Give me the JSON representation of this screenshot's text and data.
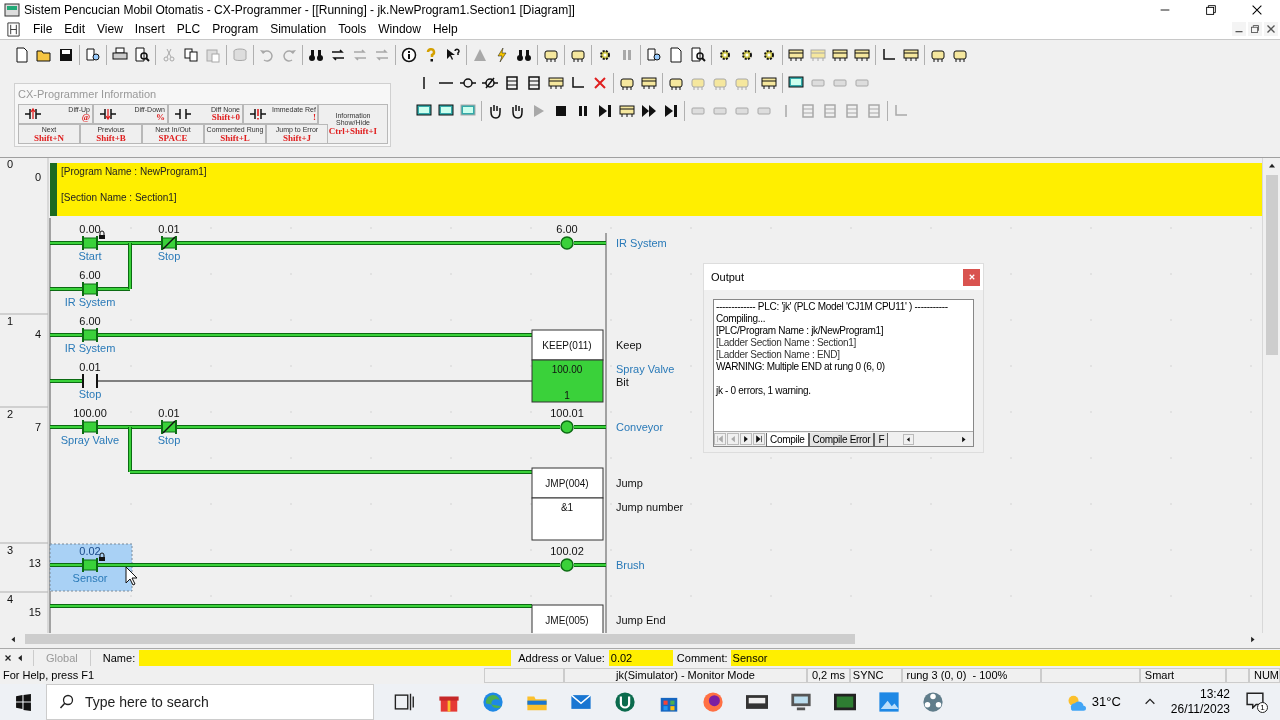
{
  "window": {
    "title": "Sistem Pencucian Mobil Otomatis - CX-Programmer - [[Running] - jk.NewProgram1.Section1 [Diagram]]"
  },
  "menu": [
    "File",
    "Edit",
    "View",
    "Insert",
    "PLC",
    "Program",
    "Simulation",
    "Tools",
    "Window",
    "Help"
  ],
  "info_panel": {
    "title": "CX-Programmer Information",
    "keys": [
      {
        "kind": "diff",
        "label": "Diff-Up",
        "key": "@"
      },
      {
        "kind": "diff",
        "label": "Diff-Down",
        "key": "%"
      },
      {
        "kind": "diff",
        "label": "Diff None",
        "key": "Shift+0"
      },
      {
        "kind": "diff",
        "label": "Immedate Ref",
        "key": "!"
      },
      {
        "kind": "info",
        "label": "Information Show/Hide",
        "key": "Ctrl+Shift+I"
      },
      {
        "kind": "nav",
        "label": "Next",
        "key": "Shift+N"
      },
      {
        "kind": "nav",
        "label": "Previous",
        "key": "Shift+B"
      },
      {
        "kind": "nav",
        "label": "Next In/Out",
        "key": "SPACE"
      },
      {
        "kind": "nav",
        "label": "Commented Rung",
        "key": "Shift+L"
      },
      {
        "kind": "nav",
        "label": "Jump to Error",
        "key": "Shift+J"
      }
    ]
  },
  "ladder": {
    "rungs": [
      {
        "number": "0",
        "step": "0",
        "comment": [
          "[Program Name : NewProgram1]",
          "[Section Name : Section1]"
        ],
        "elements": [
          {
            "kind": "contact_no",
            "address": "0.00",
            "symbol": "Start",
            "energized": true,
            "locked": true,
            "selected": false
          },
          {
            "kind": "contact_nc",
            "address": "0.01",
            "symbol": "Stop",
            "energized": true,
            "locked": false,
            "selected": false
          },
          {
            "kind": "coil",
            "address": "6.00",
            "symbol": "IR System",
            "energized": true,
            "selected": false
          },
          {
            "kind": "contact_no",
            "address": "6.00",
            "symbol": "IR System",
            "energized": true,
            "locked": false,
            "selected": false
          }
        ]
      },
      {
        "number": "1",
        "step": "4",
        "elements": [
          {
            "kind": "contact_no",
            "address": "6.00",
            "symbol": "IR System",
            "energized": true,
            "locked": false,
            "selected": false
          },
          {
            "kind": "contact_no",
            "address": "0.01",
            "symbol": "Stop",
            "energized": false,
            "locked": false,
            "selected": false
          },
          {
            "kind": "instruction",
            "mnemonic": "KEEP(011)",
            "description": "Keep",
            "selected": false,
            "operands": [
              {
                "value": "100.00",
                "current": "1",
                "symbol": "Spray Valve",
                "description": "Bit",
                "energized": true
              }
            ]
          }
        ]
      },
      {
        "number": "2",
        "step": "7",
        "elements": [
          {
            "kind": "contact_no",
            "address": "100.00",
            "symbol": "Spray Valve",
            "energized": true,
            "locked": false,
            "selected": false
          },
          {
            "kind": "contact_nc",
            "address": "0.01",
            "symbol": "Stop",
            "energized": true,
            "locked": false,
            "selected": false
          },
          {
            "kind": "coil",
            "address": "100.01",
            "symbol": "Conveyor",
            "energized": true,
            "selected": false
          },
          {
            "kind": "instruction",
            "mnemonic": "JMP(004)",
            "description": "Jump",
            "selected": false,
            "operands": [
              {
                "value": "&1",
                "description": "Jump number",
                "energized": false
              }
            ]
          }
        ]
      },
      {
        "number": "3",
        "step": "13",
        "elements": [
          {
            "kind": "contact_no",
            "address": "0.02",
            "symbol": "Sensor",
            "energized": true,
            "locked": true,
            "selected": true
          },
          {
            "kind": "coil",
            "address": "100.02",
            "symbol": "Brush",
            "energized": true,
            "selected": false
          }
        ]
      },
      {
        "number": "4",
        "step": "15",
        "elements": [
          {
            "kind": "instruction",
            "mnemonic": "JME(005)",
            "description": "Jump End",
            "selected": false
          }
        ]
      }
    ]
  },
  "output": {
    "title": "Output",
    "log": [
      "------------- PLC: 'jk' (PLC Model 'CJ1M CPU11' ) -----------",
      "Compiling...",
      "[PLC/Program Name : jk/NewProgram1]",
      "[Ladder Section Name : Section1]",
      "[Ladder Section Name : END]",
      "WARNING: Multiple END at rung 0 (6, 0)"
    ],
    "summary": [
      "jk - 0 errors, 1 warning."
    ],
    "tabs": [
      {
        "label": "Compile",
        "selected": true
      },
      {
        "label": "Compile Error",
        "selected": false
      },
      {
        "label": "F",
        "selected": false
      }
    ]
  },
  "info_bar": {
    "scope": "Global",
    "name_label": "Name:",
    "address_label": "Address or Value:",
    "address": "0.02",
    "comment_label": "Comment:",
    "comment": "Sensor"
  },
  "status_bar": {
    "help": "For Help, press F1",
    "mode": "jk(Simulator) - Monitor Mode",
    "cycle": "0,2 ms",
    "sync": "SYNC",
    "position": "rung 3 (0, 0)  - 100%",
    "edit": "Smart",
    "num": "NUM"
  },
  "taskbar": {
    "search_placeholder": "Type here to search",
    "temperature": "31°C",
    "time": "13:42",
    "date": "26/11/2023",
    "notifications": "1"
  }
}
